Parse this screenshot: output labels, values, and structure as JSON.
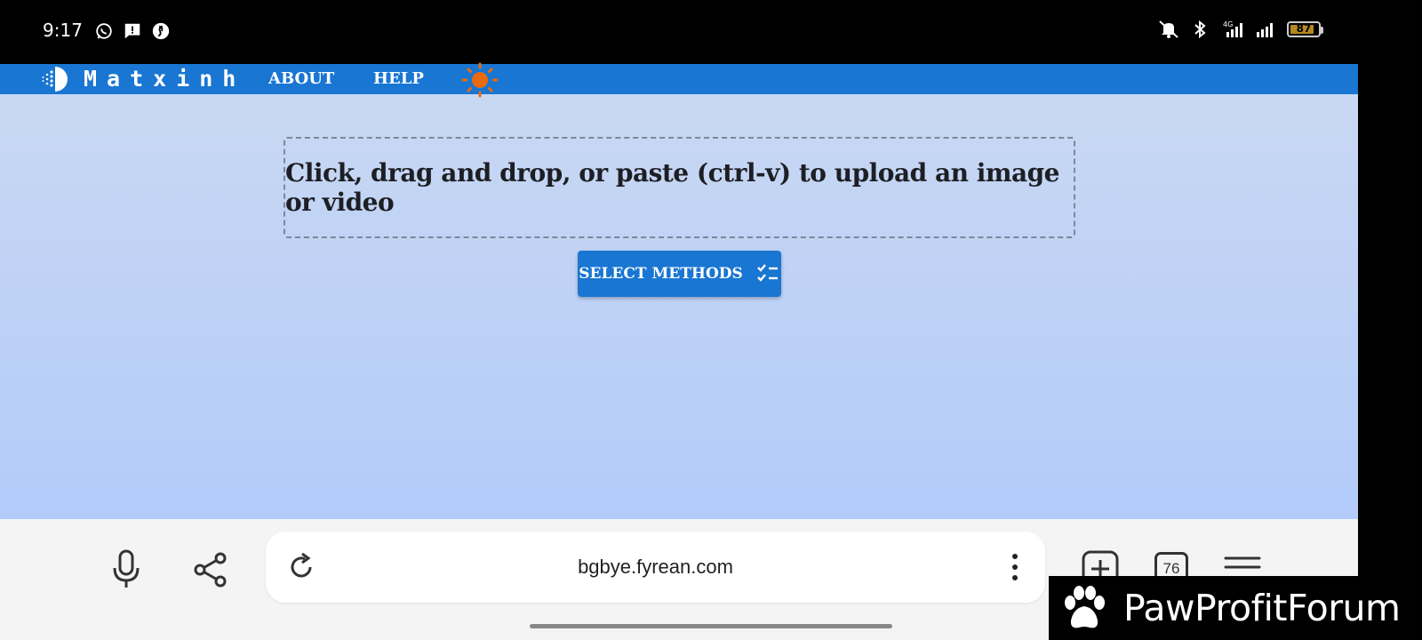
{
  "status_bar": {
    "time": "9:17",
    "left_icons": [
      "whatsapp-icon",
      "message-alert-icon",
      "shazam-icon"
    ],
    "right_icons": [
      "mute-icon",
      "bluetooth-icon",
      "signal-4g-icon",
      "signal-icon"
    ],
    "battery_level": "87",
    "battery_color": "#b38a1f"
  },
  "navbar": {
    "brand": "Matxinh",
    "links": [
      "ABOUT",
      "HELP"
    ],
    "color": "#1976d2",
    "theme_icon": "sun-icon",
    "theme_color": "#e86a10"
  },
  "main": {
    "dropzone_text": "Click, drag and drop, or paste (ctrl-v) to upload an image or video",
    "select_button_label": "SELECT METHODS",
    "select_button_icon": "checklist-icon"
  },
  "browser_toolbar": {
    "url": "bgbye.fyrean.com",
    "tab_count": "76",
    "icons": [
      "microphone-icon",
      "share-icon",
      "reload-icon",
      "more-vert-icon",
      "new-tab-icon",
      "tabs-icon",
      "menu-icon"
    ]
  },
  "watermark": {
    "text": "PawProfitForum",
    "icon": "paw-icon"
  }
}
